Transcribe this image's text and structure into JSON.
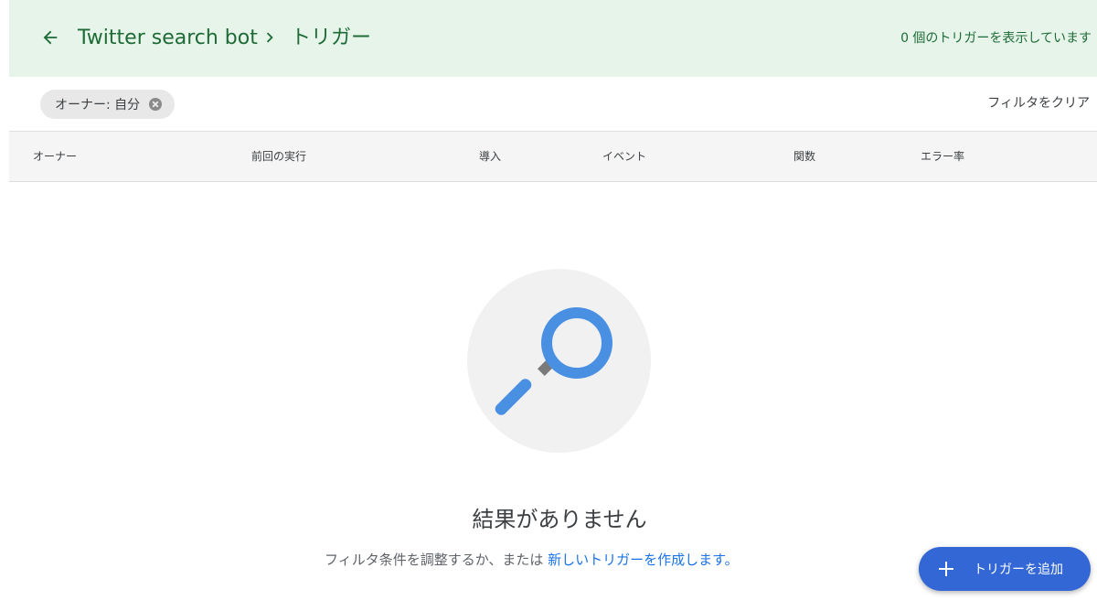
{
  "header": {
    "project_name": "Twitter search bot",
    "current_page": "トリガー",
    "trigger_count_text": "0 個のトリガーを表示しています"
  },
  "filter": {
    "chip_label": "オーナー: 自分",
    "clear_label": "フィルタをクリア"
  },
  "table": {
    "columns": [
      "オーナー",
      "前回の実行",
      "導入",
      "イベント",
      "関数",
      "エラー率"
    ]
  },
  "empty_state": {
    "title": "結果がありません",
    "description_prefix": "フィルタ条件を調整するか、または ",
    "link_text": "新しいトリガーを作成します。"
  },
  "fab": {
    "label": "トリガーを追加"
  },
  "icons": {
    "back": "arrow-back-icon",
    "separator": "chevron-right-icon",
    "chip_close": "cancel-icon",
    "empty": "magnifier-icon",
    "fab": "plus-icon"
  },
  "colors": {
    "header_bg": "#e6f4ea",
    "header_text": "#1e6b36",
    "accent": "#3367d6",
    "link": "#1a73e8",
    "magnifier": "#4a90e2"
  }
}
